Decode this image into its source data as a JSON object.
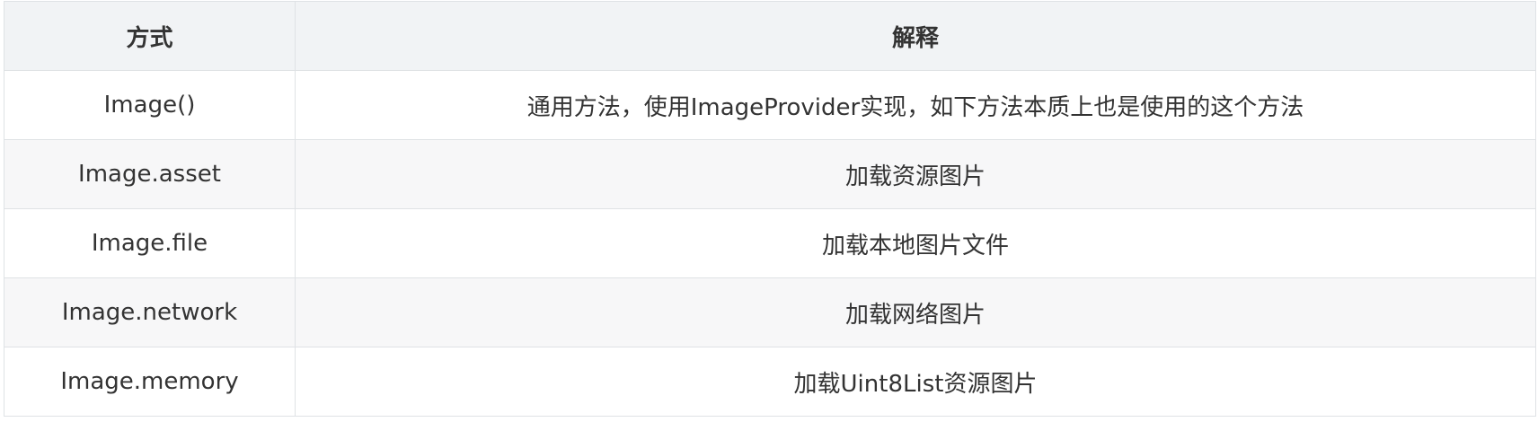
{
  "table": {
    "headers": [
      "方式",
      "解释"
    ],
    "rows": [
      {
        "method": "Image()",
        "description": "通用方法，使用ImageProvider实现，如下方法本质上也是使用的这个方法"
      },
      {
        "method": "Image.asset",
        "description": "加载资源图片"
      },
      {
        "method": "Image.file",
        "description": "加载本地图片文件"
      },
      {
        "method": "Image.network",
        "description": "加载网络图片"
      },
      {
        "method": "Image.memory",
        "description": "加载Uint8List资源图片"
      }
    ]
  },
  "colors": {
    "header_bg": "#f1f3f5",
    "stripe_bg": "#f7f7f8",
    "border": "#dfe2e5",
    "text": "#333333"
  }
}
